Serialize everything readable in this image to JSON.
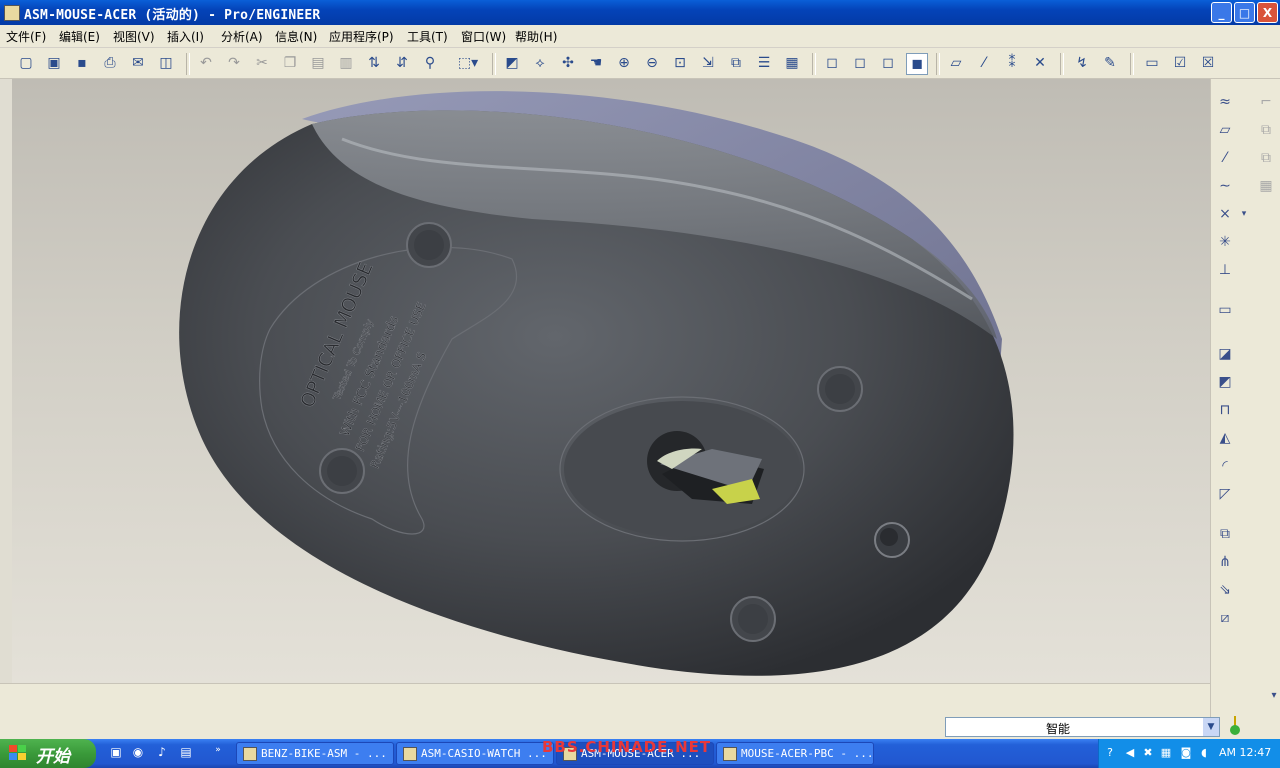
{
  "window": {
    "title": "ASM-MOUSE-ACER (活动的) - Pro/ENGINEER",
    "minimize_label": "_",
    "maximize_label": "□",
    "close_label": "X"
  },
  "menu": {
    "items": [
      {
        "label": "文件(F)"
      },
      {
        "label": "编辑(E)"
      },
      {
        "label": "视图(V)"
      },
      {
        "label": "插入(I)"
      },
      {
        "label": "分析(A)"
      },
      {
        "label": "信息(N)"
      },
      {
        "label": "应用程序(P)"
      },
      {
        "label": "工具(T)"
      },
      {
        "label": "窗口(W)"
      },
      {
        "label": "帮助(H)"
      }
    ]
  },
  "toolbar": {
    "icons": [
      "new-file-icon",
      "open-folder-icon",
      "save-icon",
      "print-icon",
      "email-icon",
      "close-window-icon",
      "undo-icon",
      "redo-icon",
      "cut-icon",
      "copy-icon",
      "paste-icon",
      "paste-special-icon",
      "regenerate-icon",
      "regenerate-manager-icon",
      "find-icon",
      "selection-filter-icon",
      "sketcher-icon",
      "spin-center-icon",
      "datum-display-icon",
      "pan-hand-icon",
      "zoom-in-icon",
      "zoom-out-icon",
      "refit-icon",
      "reorient-icon",
      "saved-views-icon",
      "layers-icon",
      "view-manager-icon",
      "wireframe-icon",
      "hidden-line-icon",
      "no-hidden-icon",
      "shading-icon",
      "datum-planes-icon",
      "datum-axes-icon",
      "datum-points-icon",
      "coordinate-system-icon",
      "context-help-icon",
      "annotate-icon",
      "window-activate-icon",
      "window-list-icon",
      "window-close-icon"
    ]
  },
  "model": {
    "label_line1": "OPTICAL MOUSE",
    "label_line2": "Tested To Comply",
    "label_line3": "With FCC Standards",
    "label_line4": "FOR HOME OR OFFICE USE",
    "label_line5": "Rating:5V---100mA  S"
  },
  "rightbar": {
    "icons": [
      "datum-curve-icon",
      "datum-plane-icon",
      "datum-axis-icon",
      "sketched-curve-icon",
      "datum-point-icon",
      "offset-point-icon",
      "field-point-icon",
      "coordinate-sys-icon",
      "analysis-icon",
      "extrude-icon",
      "revolve-icon",
      "sweep-icon",
      "blend-icon",
      "round-icon",
      "chamfer-icon",
      "copy-feature-icon",
      "mirror-icon",
      "merge-icon",
      "trim-icon",
      "offset-icon",
      "thicken-icon",
      "solidify-icon",
      "pattern-icon"
    ]
  },
  "status": {
    "filter_value": "智能"
  },
  "taskbar": {
    "start_label": "开始",
    "tasks": [
      {
        "label": "BENZ-BIKE-ASM - ..."
      },
      {
        "label": "ASM-CASIO-WATCH ..."
      },
      {
        "label": "ASM-MOUSE-ACER ..."
      },
      {
        "label": "MOUSE-ACER-PBC - ..."
      }
    ],
    "clock": "AM 12:47",
    "watermark": "BBS.CHINADE.NET"
  },
  "colors": {
    "title_blue": "#0443b8",
    "mouse_body": "#4a4d52",
    "mouse_rim": "#7c82a8",
    "viewport_bg": "#d2cfc6",
    "lens_yellow": "#c8d24a"
  }
}
